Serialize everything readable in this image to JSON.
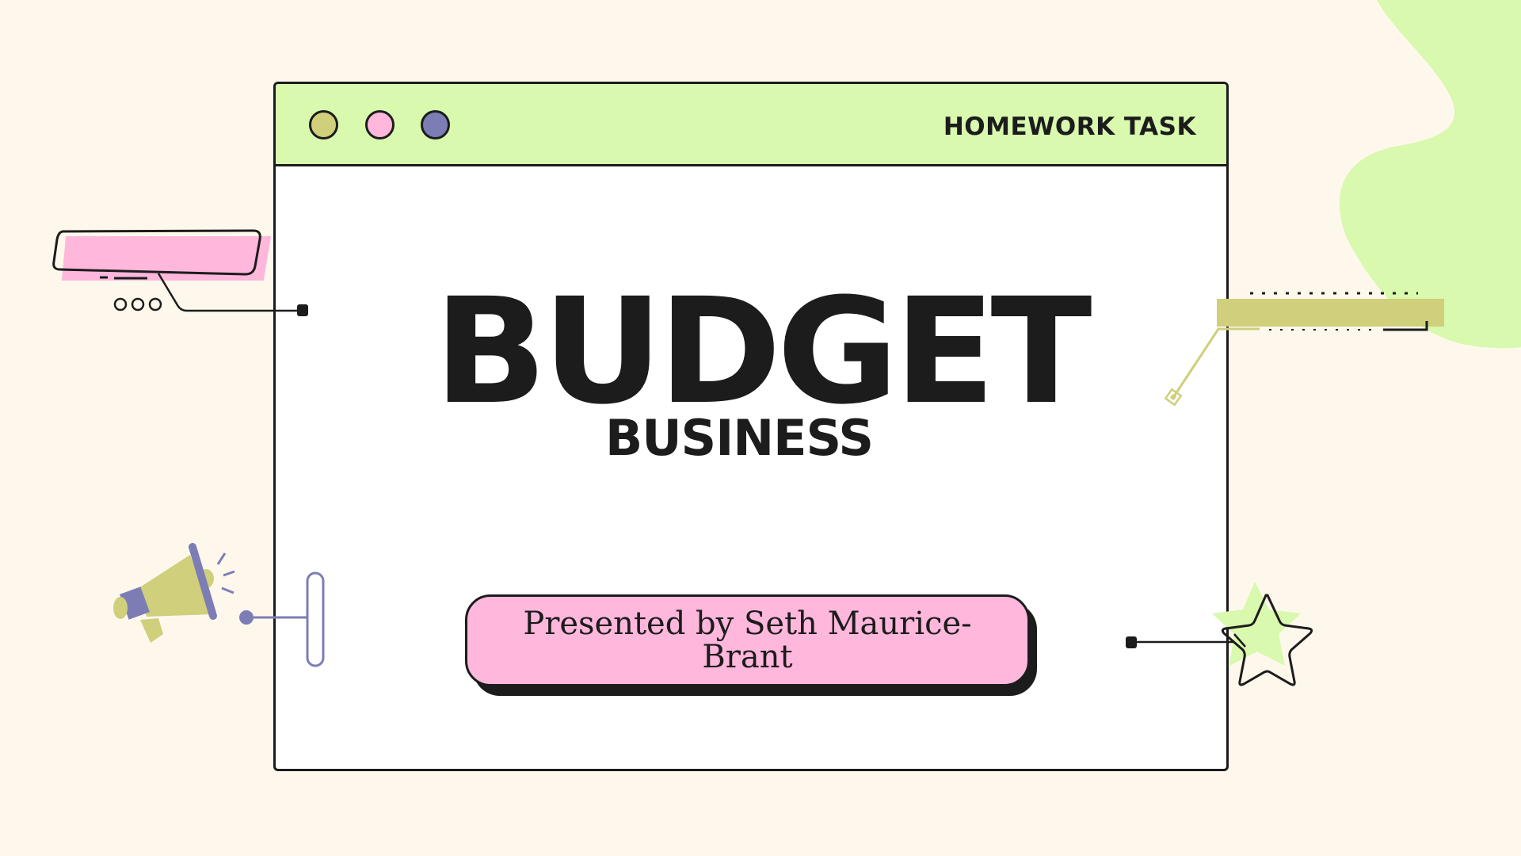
{
  "slide": {
    "window_label": "HOMEWORK TASK",
    "title": "BUDGET",
    "subtitle": "BUSINESS",
    "presenter": "Presented by Seth Maurice-Brant"
  },
  "colors": {
    "background": "#fef8ec",
    "lime": "#d8f9ae",
    "olive": "#cfcf7c",
    "pink": "#ffb7dc",
    "purple": "#7d7db6",
    "ink": "#1c1c1c"
  },
  "icons": [
    "window-dot",
    "speech-bubble-icon",
    "megaphone-icon",
    "star-icon",
    "slider-handle-icon"
  ]
}
